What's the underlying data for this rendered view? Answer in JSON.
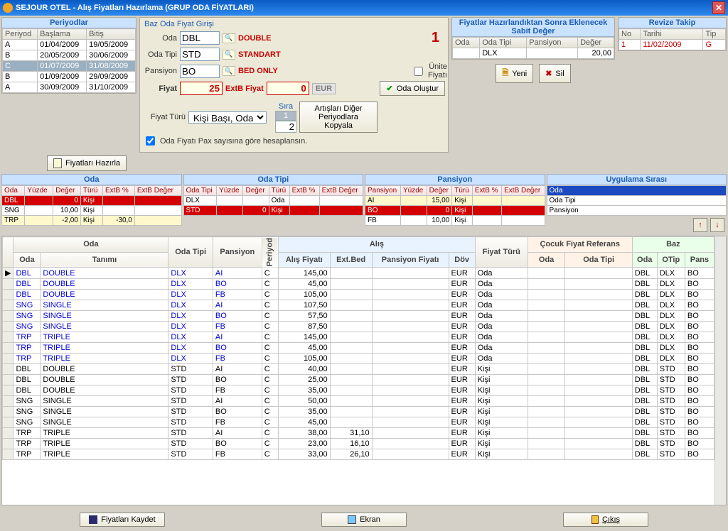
{
  "title": "SEJOUR OTEL - Alış Fiyatları Hazırlama (GRUP ODA FİYATLARI)",
  "periods": {
    "title": "Periyodlar",
    "cols": [
      "Periyod",
      "Başlama",
      "Bitiş"
    ],
    "rows": [
      {
        "p": "A",
        "b": "01/04/2009",
        "e": "19/05/2009",
        "sel": false
      },
      {
        "p": "B",
        "b": "20/05/2009",
        "e": "30/06/2009",
        "sel": false
      },
      {
        "p": "C",
        "b": "01/07/2009",
        "e": "31/08/2009",
        "sel": true
      },
      {
        "p": "B",
        "b": "01/09/2009",
        "e": "29/09/2009",
        "sel": false
      },
      {
        "p": "A",
        "b": "30/09/2009",
        "e": "31/10/2009",
        "sel": false
      }
    ]
  },
  "baz": {
    "title": "Baz Oda Fiyat Girişi",
    "oda_lbl": "Oda",
    "oda_val": "DBL",
    "oda_txt": "DOUBLE",
    "odatipi_lbl": "Oda Tipi",
    "odatipi_val": "STD",
    "odatipi_txt": "STANDART",
    "pansiyon_lbl": "Pansiyon",
    "pansiyon_val": "BO",
    "pansiyon_txt": "BED ONLY",
    "fiyat_lbl": "Fiyat",
    "fiyat_val": "25",
    "extb_lbl": "ExtB Fiyat",
    "extb_val": "0",
    "cur": "EUR",
    "unite_lbl": "Ünite Fiyatı",
    "olustur_btn": "Oda Oluştur",
    "big1": "1",
    "fiyatturu_lbl": "Fiyat Türü",
    "fiyatturu_val": "Kişi Başı, Oda",
    "pax_chk": "Oda Fiyatı Pax sayısına göre hesaplansın.",
    "sira_lbl": "Sıra",
    "sira_val": "1",
    "sira_spin": "2",
    "kopyala_btn": "Artışları Diğer Periyodlara Kopyala",
    "hazirla_btn": "Fiyatları Hazırla"
  },
  "sabit": {
    "title": "Fiyatlar Hazırlandıktan Sonra Eklenecek Sabit Değer",
    "cols": [
      "Oda",
      "Oda Tipi",
      "Pansiyon",
      "Değer"
    ],
    "rows": [
      {
        "oda": "",
        "otip": "DLX",
        "pan": "",
        "deger": "20,00"
      }
    ],
    "yeni": "Yeni",
    "sil": "Sil"
  },
  "revize": {
    "title": "Revize Takip",
    "cols": [
      "No",
      "Tarihi",
      "Tip"
    ],
    "rows": [
      {
        "no": "1",
        "t": "11/02/2009",
        "tip": "G"
      }
    ]
  },
  "quads": {
    "oda": {
      "title": "Oda",
      "cols": [
        "Oda",
        "Yüzde",
        "Değer",
        "Türü",
        "ExtB %",
        "ExtB Değer"
      ],
      "rows": [
        {
          "a": "DBL",
          "y": "",
          "d": "0",
          "t": "Kişi",
          "ep": "",
          "ed": "",
          "cls": "row-red"
        },
        {
          "a": "SNG",
          "y": "",
          "d": "10,00",
          "t": "Kişi",
          "ep": "",
          "ed": "",
          "cls": ""
        },
        {
          "a": "TRP",
          "y": "",
          "d": "-2,00",
          "t": "Kişi",
          "ep": "-30,0",
          "ed": "",
          "cls": "row-yel"
        }
      ]
    },
    "odatipi": {
      "title": "Oda Tipi",
      "cols": [
        "Oda Tipi",
        "Yüzde",
        "Değer",
        "Türü",
        "ExtB %",
        "ExtB Değer"
      ],
      "rows": [
        {
          "a": "DLX",
          "y": "",
          "d": "",
          "t": "Oda",
          "ep": "",
          "ed": "",
          "cls": ""
        },
        {
          "a": "STD",
          "y": "",
          "d": "0",
          "t": "Kişi",
          "ep": "",
          "ed": "",
          "cls": "row-red"
        }
      ]
    },
    "pansiyon": {
      "title": "Pansiyon",
      "cols": [
        "Pansiyon",
        "Yüzde",
        "Değer",
        "Türü",
        "ExtB %",
        "ExtB Değer"
      ],
      "rows": [
        {
          "a": "AI",
          "y": "",
          "d": "15,00",
          "t": "Kişi",
          "ep": "",
          "ed": "",
          "cls": "row-yel"
        },
        {
          "a": "BO",
          "y": "",
          "d": "0",
          "t": "Kişi",
          "ep": "",
          "ed": "",
          "cls": "row-red"
        },
        {
          "a": "FB",
          "y": "",
          "d": "10,00",
          "t": "Kişi",
          "ep": "",
          "ed": "",
          "cls": ""
        }
      ]
    }
  },
  "uyg": {
    "title": "Uygulama Sırası",
    "rows": [
      "Oda",
      "Oda Tipi",
      "Pansiyon"
    ]
  },
  "main": {
    "group_oda": "Oda",
    "group_alis": "Alış",
    "group_cocuk": "Çocuk Fiyat Referans",
    "group_baz": "Baz",
    "cols": [
      "Oda",
      "Tanımı",
      "Oda Tipi",
      "Pansiyon",
      "Periyod",
      "Alış Fiyatı",
      "Ext.Bed",
      "Pansiyon Fiyatı",
      "Döv",
      "Fiyat Türü",
      "Oda",
      "Oda Tipi",
      "Oda",
      "OTip",
      "Pans"
    ],
    "rows": [
      {
        "blue": true,
        "oda": "DBL",
        "tan": "DOUBLE",
        "ot": "DLX",
        "pn": "AI",
        "per": "C",
        "af": "145,00",
        "eb": "",
        "pf": "",
        "dov": "EUR",
        "ft": "Oda",
        "co": "",
        "cot": "",
        "bo": "DBL",
        "bot": "DLX",
        "bp": "BO"
      },
      {
        "blue": true,
        "oda": "DBL",
        "tan": "DOUBLE",
        "ot": "DLX",
        "pn": "BO",
        "per": "C",
        "af": "45,00",
        "eb": "",
        "pf": "",
        "dov": "EUR",
        "ft": "Oda",
        "co": "",
        "cot": "",
        "bo": "DBL",
        "bot": "DLX",
        "bp": "BO"
      },
      {
        "blue": true,
        "oda": "DBL",
        "tan": "DOUBLE",
        "ot": "DLX",
        "pn": "FB",
        "per": "C",
        "af": "105,00",
        "eb": "",
        "pf": "",
        "dov": "EUR",
        "ft": "Oda",
        "co": "",
        "cot": "",
        "bo": "DBL",
        "bot": "DLX",
        "bp": "BO"
      },
      {
        "blue": true,
        "oda": "SNG",
        "tan": "SINGLE",
        "ot": "DLX",
        "pn": "AI",
        "per": "C",
        "af": "107,50",
        "eb": "",
        "pf": "",
        "dov": "EUR",
        "ft": "Oda",
        "co": "",
        "cot": "",
        "bo": "DBL",
        "bot": "DLX",
        "bp": "BO"
      },
      {
        "blue": true,
        "oda": "SNG",
        "tan": "SINGLE",
        "ot": "DLX",
        "pn": "BO",
        "per": "C",
        "af": "57,50",
        "eb": "",
        "pf": "",
        "dov": "EUR",
        "ft": "Oda",
        "co": "",
        "cot": "",
        "bo": "DBL",
        "bot": "DLX",
        "bp": "BO"
      },
      {
        "blue": true,
        "oda": "SNG",
        "tan": "SINGLE",
        "ot": "DLX",
        "pn": "FB",
        "per": "C",
        "af": "87,50",
        "eb": "",
        "pf": "",
        "dov": "EUR",
        "ft": "Oda",
        "co": "",
        "cot": "",
        "bo": "DBL",
        "bot": "DLX",
        "bp": "BO"
      },
      {
        "blue": true,
        "oda": "TRP",
        "tan": "TRIPLE",
        "ot": "DLX",
        "pn": "AI",
        "per": "C",
        "af": "145,00",
        "eb": "",
        "pf": "",
        "dov": "EUR",
        "ft": "Oda",
        "co": "",
        "cot": "",
        "bo": "DBL",
        "bot": "DLX",
        "bp": "BO"
      },
      {
        "blue": true,
        "oda": "TRP",
        "tan": "TRIPLE",
        "ot": "DLX",
        "pn": "BO",
        "per": "C",
        "af": "45,00",
        "eb": "",
        "pf": "",
        "dov": "EUR",
        "ft": "Oda",
        "co": "",
        "cot": "",
        "bo": "DBL",
        "bot": "DLX",
        "bp": "BO"
      },
      {
        "blue": true,
        "oda": "TRP",
        "tan": "TRIPLE",
        "ot": "DLX",
        "pn": "FB",
        "per": "C",
        "af": "105,00",
        "eb": "",
        "pf": "",
        "dov": "EUR",
        "ft": "Oda",
        "co": "",
        "cot": "",
        "bo": "DBL",
        "bot": "DLX",
        "bp": "BO"
      },
      {
        "blue": false,
        "oda": "DBL",
        "tan": "DOUBLE",
        "ot": "STD",
        "pn": "AI",
        "per": "C",
        "af": "40,00",
        "eb": "",
        "pf": "",
        "dov": "EUR",
        "ft": "Kişi",
        "co": "",
        "cot": "",
        "bo": "DBL",
        "bot": "STD",
        "bp": "BO"
      },
      {
        "blue": false,
        "oda": "DBL",
        "tan": "DOUBLE",
        "ot": "STD",
        "pn": "BO",
        "per": "C",
        "af": "25,00",
        "eb": "",
        "pf": "",
        "dov": "EUR",
        "ft": "Kişi",
        "co": "",
        "cot": "",
        "bo": "DBL",
        "bot": "STD",
        "bp": "BO"
      },
      {
        "blue": false,
        "oda": "DBL",
        "tan": "DOUBLE",
        "ot": "STD",
        "pn": "FB",
        "per": "C",
        "af": "35,00",
        "eb": "",
        "pf": "",
        "dov": "EUR",
        "ft": "Kişi",
        "co": "",
        "cot": "",
        "bo": "DBL",
        "bot": "STD",
        "bp": "BO"
      },
      {
        "blue": false,
        "oda": "SNG",
        "tan": "SINGLE",
        "ot": "STD",
        "pn": "AI",
        "per": "C",
        "af": "50,00",
        "eb": "",
        "pf": "",
        "dov": "EUR",
        "ft": "Kişi",
        "co": "",
        "cot": "",
        "bo": "DBL",
        "bot": "STD",
        "bp": "BO"
      },
      {
        "blue": false,
        "oda": "SNG",
        "tan": "SINGLE",
        "ot": "STD",
        "pn": "BO",
        "per": "C",
        "af": "35,00",
        "eb": "",
        "pf": "",
        "dov": "EUR",
        "ft": "Kişi",
        "co": "",
        "cot": "",
        "bo": "DBL",
        "bot": "STD",
        "bp": "BO"
      },
      {
        "blue": false,
        "oda": "SNG",
        "tan": "SINGLE",
        "ot": "STD",
        "pn": "FB",
        "per": "C",
        "af": "45,00",
        "eb": "",
        "pf": "",
        "dov": "EUR",
        "ft": "Kişi",
        "co": "",
        "cot": "",
        "bo": "DBL",
        "bot": "STD",
        "bp": "BO"
      },
      {
        "blue": false,
        "oda": "TRP",
        "tan": "TRIPLE",
        "ot": "STD",
        "pn": "AI",
        "per": "C",
        "af": "38,00",
        "eb": "31,10",
        "pf": "",
        "dov": "EUR",
        "ft": "Kişi",
        "co": "",
        "cot": "",
        "bo": "DBL",
        "bot": "STD",
        "bp": "BO"
      },
      {
        "blue": false,
        "oda": "TRP",
        "tan": "TRIPLE",
        "ot": "STD",
        "pn": "BO",
        "per": "C",
        "af": "23,00",
        "eb": "16,10",
        "pf": "",
        "dov": "EUR",
        "ft": "Kişi",
        "co": "",
        "cot": "",
        "bo": "DBL",
        "bot": "STD",
        "bp": "BO"
      },
      {
        "blue": false,
        "oda": "TRP",
        "tan": "TRIPLE",
        "ot": "STD",
        "pn": "FB",
        "per": "C",
        "af": "33,00",
        "eb": "26,10",
        "pf": "",
        "dov": "EUR",
        "ft": "Kişi",
        "co": "",
        "cot": "",
        "bo": "DBL",
        "bot": "STD",
        "bp": "BO"
      }
    ]
  },
  "bottom": {
    "kaydet": "Fiyatları Kaydet",
    "ekran": "Ekran",
    "cikis": "Çıkış"
  }
}
